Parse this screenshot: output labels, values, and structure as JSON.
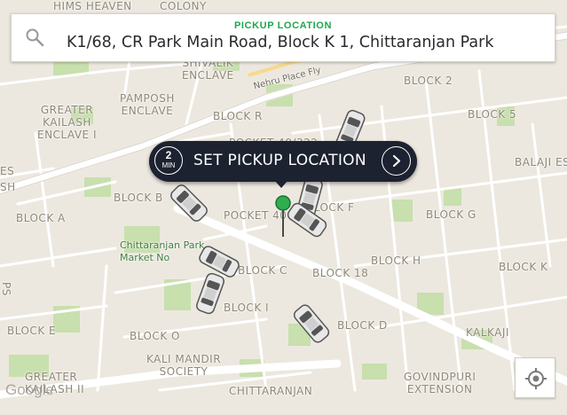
{
  "search": {
    "caption": "PICKUP LOCATION",
    "address": "K1/68, CR Park Main Road, Block K 1, Chittaranjan Park",
    "icon": "search-icon"
  },
  "pickup_button": {
    "eta_value": "2",
    "eta_unit": "MIN",
    "label": "SET PICKUP LOCATION",
    "icon": "chevron-right-icon"
  },
  "map": {
    "labels": {
      "colony_top": "COLONY",
      "hims_top": "HIMS HEAVEN",
      "shivalik_enclave": "SHIVALIK\nENCLAVE",
      "nehru_place_fly": "Nehru Place Fly",
      "block_2": "BLOCK 2",
      "pamposh_enclave": "PAMPOSH\nENCLAVE",
      "greater_kailash_1": "GREATER\nKAILASH\nENCLAVE I",
      "block_r": "BLOCK R",
      "block_5": "BLOCK 5",
      "pocket_40_top": "POCKET 40/322",
      "balaji_es": "BALAJI ES",
      "block_b": "BLOCK B",
      "pocket_40": "POCKET 40",
      "block_f": "BLOCK F",
      "block_g": "BLOCK G",
      "block_a": "BLOCK A",
      "chittaranjan_market": "Chittaranjan Park\nMarket No",
      "block_c": "BLOCK C",
      "block_18": "BLOCK 18",
      "block_h": "BLOCK H",
      "block_k": "BLOCK K",
      "block_i": "BLOCK I",
      "block_e": "BLOCK E",
      "block_o": "BLOCK O",
      "block_d": "BLOCK D",
      "kalkaji": "KALKAJI",
      "kali_mandir_society": "KALI MANDIR\nSOCIETY",
      "greater_kailash_2": "GREATER\nKAILASH II",
      "chittaranjan": "CHITTARANJAN",
      "govindpuri_extension": "GOVINDPURI\nEXTENSION",
      "sh_left": "SH",
      "es_left": "ES",
      "ps_left": "PS"
    },
    "attribution": "Google",
    "pin_icon": "location-pin-icon"
  },
  "locate_button": {
    "icon": "crosshair-icon"
  },
  "colors": {
    "accent_green": "#1fa74b",
    "dark_pill": "#1d2230",
    "map_bg": "#ece8df",
    "park": "#c8dfae"
  }
}
